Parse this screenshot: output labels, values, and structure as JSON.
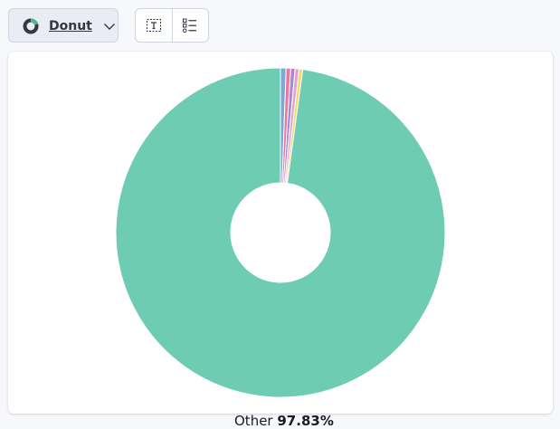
{
  "toolbar": {
    "chart_type_label": "Donut",
    "chart_type_icon": "donut-chart-icon",
    "dropdown_icon": "chevron-down-icon",
    "buttons": [
      {
        "name": "toggle-labels",
        "icon": "text-label-icon"
      },
      {
        "name": "toggle-legend",
        "icon": "legend-list-icon"
      }
    ]
  },
  "colors": {
    "other": "#6dccb1",
    "slice_blue": "#79aad9",
    "slice_pink": "#ee789d",
    "slice_purple": "#a987d1",
    "slice_orange": "#e4a6c7",
    "slice_yellow": "#f1d86f"
  },
  "chart_data": {
    "type": "pie",
    "variant": "donut",
    "slices": [
      {
        "label": "",
        "value": 0.55,
        "color": "#79aad9"
      },
      {
        "label": "",
        "value": 0.45,
        "color": "#ee789d"
      },
      {
        "label": "",
        "value": 0.42,
        "color": "#a987d1"
      },
      {
        "label": "",
        "value": 0.4,
        "color": "#e4a6c7"
      },
      {
        "label": "",
        "value": 0.35,
        "color": "#f1d86f"
      },
      {
        "label": "Other",
        "value": 97.83,
        "color": "#6dccb1"
      }
    ],
    "visible_label": {
      "name": "Other",
      "percent": "97.83%"
    }
  }
}
